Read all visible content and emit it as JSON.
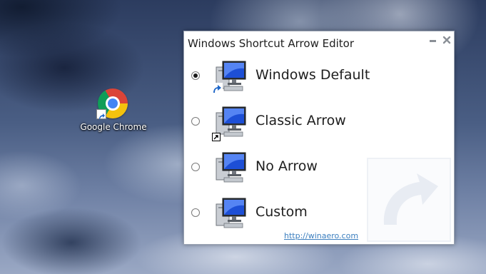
{
  "desktop": {
    "icon_label": "Google Chrome",
    "icon_name": "google-chrome-icon"
  },
  "window": {
    "title": "Windows Shortcut Arrow Editor",
    "minimize_icon": "minimize-icon",
    "close_icon": "close-icon",
    "options": [
      {
        "label": "Windows Default",
        "selected": true,
        "overlay": "windows-default-arrow"
      },
      {
        "label": "Classic Arrow",
        "selected": false,
        "overlay": "classic-arrow"
      },
      {
        "label": "No Arrow",
        "selected": false,
        "overlay": "none"
      },
      {
        "label": "Custom",
        "selected": false,
        "overlay": "none"
      }
    ],
    "link_text": "http://winaero.com"
  },
  "colors": {
    "link": "#3c7fbf",
    "arrow_blue": "#1f67c8",
    "window_border": "#9aa3b2"
  }
}
